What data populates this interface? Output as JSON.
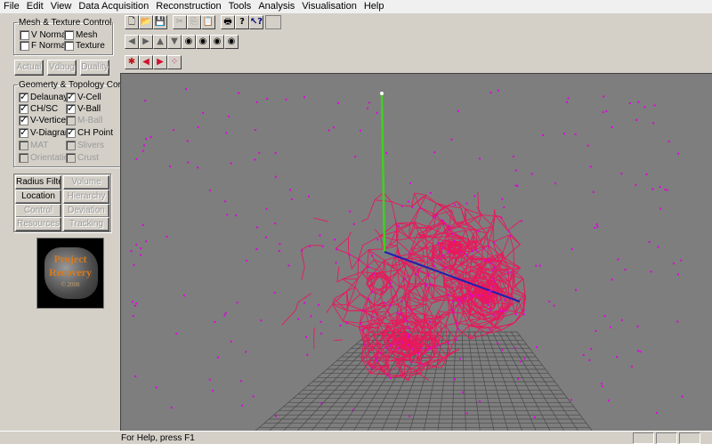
{
  "menu": [
    "File",
    "Edit",
    "View",
    "Data Acquisition",
    "Reconstruction",
    "Tools",
    "Analysis",
    "Visualisation",
    "Help"
  ],
  "mesh_group": {
    "title": "Mesh & Texture  Control",
    "v_normals": "V Norma",
    "f_normals": "F Normals",
    "mesh": "Mesh",
    "texture": "Texture"
  },
  "mode_buttons": {
    "actual": "Actual",
    "vdbug": "Vdbug",
    "duality": "Duality"
  },
  "geometry_group": {
    "title": "Geomerty & Topology Control",
    "delaunay": "Delaunay",
    "v_cell": "V-Cell",
    "ch_sc": "CH/SC",
    "v_ball": "V-Ball",
    "v_vertices": "V-Vertice",
    "m_ball": "M-Ball",
    "v_diagram": "V-Diagram",
    "ch_point": "CH Point",
    "mat": "MAT",
    "slivers": "Slivers",
    "orientation": "Orientation",
    "crust": "Crust"
  },
  "tool_buttons": {
    "radius_filter": "Radius Filter",
    "volume": "Volume",
    "location": "Location",
    "hierarchy": "Hierarchy",
    "control": "Control",
    "deviation": "Deviation",
    "resources": "Resources",
    "tracking": "Tracking"
  },
  "logo": {
    "line1": "Project",
    "line2": "Recovery",
    "line3": "© 2008"
  },
  "status": {
    "text": "For Help, press F1"
  },
  "colors": {
    "mesh": "#e8195c",
    "points": "#e000e0",
    "axis_y": "#40d020",
    "axis_z": "#2020b0",
    "background": "#7e7e7e"
  }
}
